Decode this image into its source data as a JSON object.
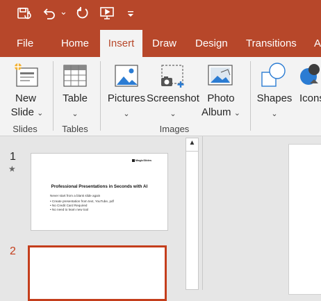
{
  "colors": {
    "accent": "#b7472a",
    "ribbon_bg": "#f3f3f3",
    "panel_bg": "#e6e6e6",
    "selected_slide_border": "#c43e1c"
  },
  "qat": {
    "icons": [
      "autosave-icon",
      "undo-icon",
      "undo-dropdown-icon",
      "redo-icon",
      "present-from-start-icon",
      "customize-qat-icon"
    ],
    "chevron": "⌄"
  },
  "tabs": [
    {
      "label": "File"
    },
    {
      "label": "Home"
    },
    {
      "label": "Insert",
      "active": true
    },
    {
      "label": "Draw"
    },
    {
      "label": "Design"
    },
    {
      "label": "Transitions"
    },
    {
      "label": "A"
    }
  ],
  "ribbon": {
    "new_slide": {
      "line1": "New",
      "line2": "Slide",
      "icon": "new-slide-icon"
    },
    "table": {
      "label": "Table",
      "icon": "table-icon"
    },
    "pictures": {
      "label": "Pictures",
      "icon": "pictures-icon"
    },
    "screenshot": {
      "label": "Screenshot",
      "icon": "screenshot-icon"
    },
    "photo_album": {
      "line1": "Photo",
      "line2": "Album",
      "icon": "photo-album-icon"
    },
    "shapes": {
      "label": "Shapes",
      "icon": "shapes-icon"
    },
    "icons_btn": {
      "label": "Icons",
      "icon": "icons-icon"
    },
    "chevron": "⌄",
    "groups": {
      "slides": "Slides",
      "tables": "Tables",
      "images": "Images"
    }
  },
  "slides": [
    {
      "number": "1",
      "star": "★",
      "brand": "MagicSlides",
      "title": "Professional Presentations in Seconds with AI",
      "lines": [
        "Never start from a blank slide again",
        "• Create presentation from text, YouTube, pdf",
        "• No Credit Card Required",
        "• No need to learn new tool"
      ]
    },
    {
      "number": "2",
      "selected": true
    }
  ],
  "scrollbar": {
    "up_arrow": "▲"
  }
}
